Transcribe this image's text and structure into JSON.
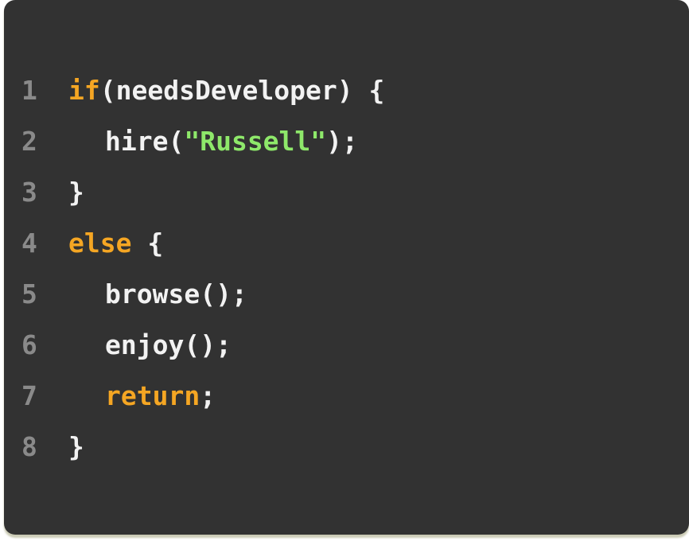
{
  "code": {
    "lines": [
      {
        "number": "1",
        "indent": false,
        "tokens": [
          {
            "type": "kw",
            "text": "if"
          },
          {
            "type": "txt",
            "text": "(needsDeveloper) {"
          }
        ]
      },
      {
        "number": "2",
        "indent": true,
        "tokens": [
          {
            "type": "txt",
            "text": "hire("
          },
          {
            "type": "str",
            "text": "\"Russell\""
          },
          {
            "type": "txt",
            "text": ");"
          }
        ]
      },
      {
        "number": "3",
        "indent": false,
        "tokens": [
          {
            "type": "txt",
            "text": "}"
          }
        ]
      },
      {
        "number": "4",
        "indent": false,
        "tokens": [
          {
            "type": "kw",
            "text": "else"
          },
          {
            "type": "txt",
            "text": " {"
          }
        ]
      },
      {
        "number": "5",
        "indent": true,
        "tokens": [
          {
            "type": "txt",
            "text": "browse();"
          }
        ]
      },
      {
        "number": "6",
        "indent": true,
        "tokens": [
          {
            "type": "txt",
            "text": "enjoy();"
          }
        ]
      },
      {
        "number": "7",
        "indent": true,
        "tokens": [
          {
            "type": "kw",
            "text": "return"
          },
          {
            "type": "txt",
            "text": ";"
          }
        ]
      },
      {
        "number": "8",
        "indent": false,
        "tokens": [
          {
            "type": "txt",
            "text": "}"
          }
        ]
      }
    ]
  },
  "colors": {
    "background": "#323232",
    "keyword": "#f5a623",
    "string": "#8ee86a",
    "text": "#f2f2f2",
    "line_number": "#8a8a8a"
  }
}
